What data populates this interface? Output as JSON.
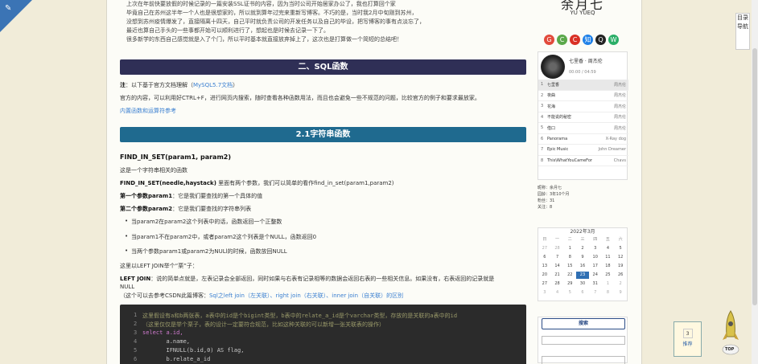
{
  "intro": {
    "lines": [
      "上次在年前快要放假的时候记录的一篇安装SSL证书的内容，因为当时公司开始居家办公了，我也打算回个家",
      "毕竟自己在苏州这半年一个人也是很想家的，所以就到算年过完来重新写博客。不巧的是，当时我2月中旬刚到苏州，",
      "没想到苏州疫情爆发了，直接隔离十四天，自己平时就负责公司的开发任务以及自己的毕设，把写博客的事有点淡忘了，",
      "最近也算自己手头的一些事都开始可以顺利进行了，想起也是时候去记录一下了。",
      "很多新学的东西自己感觉就是入了个门，所以平时基本就直接放弃掉上了，这次也是打算做一个简短的总结吧！"
    ]
  },
  "section2": {
    "title": "二、SQL函数",
    "note_label": "注",
    "note_text": "：以下基于官方文档理解（",
    "note_link": "MySQL5.7文档",
    "note_end": "）",
    "desc": "官方的内容，可以利用好CTRL+F，进行网页内搜索，随时查看各种函数用法，而且也会避免一些不规范的问题，比较官方的例子和要求最放家。",
    "ref_link": "内置函数和运算符参考"
  },
  "section21": {
    "title": "2.1字符串函数",
    "func_title": "FIND_IN_SET(param1, param2)",
    "func_desc": "这是一个字符串相关的函数",
    "usage_bold": "FIND_IN_SET(needle,haystack)",
    "usage_rest": " 里面有两个参数，我们可以简单的看作find_in_set(param1,param2)",
    "param1_bold": "第一个参数param1",
    "param1_rest": "：它是我们要查找的第一个具体的值",
    "param2_bold": "第二个参数param2",
    "param2_rest": "：它是我们要查找的字符串列表",
    "bullets": [
      "当param2在param2这个列表中的话，函数返回一个正整数",
      "当param1不在param2中，或者param2这个列表是个NULL，函数返回0",
      "当两个参数param1或param2为NULl的时候，函数放回NULL"
    ],
    "leftjoin_intro": "这里以LEFT JOIN举个“栗”子：",
    "leftjoin_bold": "LEFT JOIN",
    "leftjoin_rest": "：说的简单点就是，左表记录会全部返回，同时如果与右表有记录相等的数据会返回右表的一些相关信息。如果没有，右表返回的记录就是",
    "leftjoin_null": "NULL",
    "ref_prefix": "（这个可以去参考CSDN此篇博客：",
    "ref_links": [
      "Sql之left join（左关联）、right join（右关联）、inner join（自关联）的区别"
    ],
    "code": [
      {
        "n": "1",
        "text": "这里假设有a和b两张表，a表中的id是个bigint类型，b表中的relate_a_id是个varchar类型，存放的是关联的a表中的id"
      },
      {
        "n": "2",
        "text": "（这里仅仅是举个栗子，表的设计一定要符合规范，比如这种关联的可以新增一张关联表的操作）"
      },
      {
        "n": "3",
        "text": "select a.id,"
      },
      {
        "n": "4",
        "text": "       a.name,"
      },
      {
        "n": "5",
        "text": "       IFNULL(b.id,0) AS flag,"
      },
      {
        "n": "6",
        "text": "       b.relate_a_id"
      }
    ]
  },
  "logo": {
    "big": "余月七",
    "sub": "YU YUEQ"
  },
  "player": {
    "song": "七里香 · 周杰伦",
    "time": "00:00 / 04:59",
    "songs": [
      {
        "n": "1",
        "t": "七里香",
        "a": "周杰伦"
      },
      {
        "n": "2",
        "t": "夜曲",
        "a": "周杰伦"
      },
      {
        "n": "3",
        "t": "花海",
        "a": "周杰伦"
      },
      {
        "n": "4",
        "t": "不能说的秘密",
        "a": "周杰伦"
      },
      {
        "n": "5",
        "t": "借口",
        "a": "周杰伦"
      },
      {
        "n": "6",
        "t": "Panorama",
        "a": "X-Ray dog"
      },
      {
        "n": "7",
        "t": "Epic Music",
        "a": "John Dreamer"
      },
      {
        "n": "8",
        "t": "This\\WhatYouCameFor",
        "a": "Chavs"
      }
    ]
  },
  "stats": {
    "lines": [
      "昵称：余月七",
      "园龄：3年10个月",
      "粉丝：31",
      "关注：8"
    ]
  },
  "calendar": {
    "title": "2022年3月",
    "weekdays": [
      "日",
      "一",
      "二",
      "三",
      "四",
      "五",
      "六"
    ],
    "days": [
      "27",
      "28",
      "1",
      "2",
      "3",
      "4",
      "5",
      "6",
      "7",
      "8",
      "9",
      "10",
      "11",
      "12",
      "13",
      "14",
      "15",
      "16",
      "17",
      "18",
      "19",
      "20",
      "21",
      "22",
      "23",
      "24",
      "25",
      "26",
      "27",
      "28",
      "29",
      "30",
      "31",
      "1",
      "2",
      "3",
      "4",
      "5",
      "6",
      "7",
      "8",
      "9"
    ]
  },
  "search": {
    "button": "搜索"
  },
  "toc": {
    "label": "目录导航"
  },
  "like": {
    "count": "3",
    "label": "推荐"
  },
  "rocket": {
    "label": "TOP"
  }
}
